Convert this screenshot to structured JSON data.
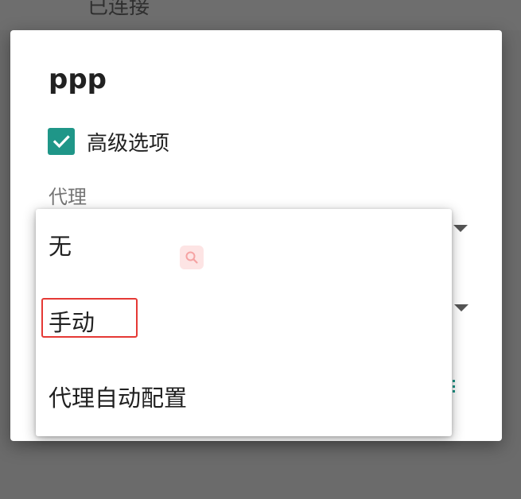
{
  "background": {
    "status_text": "已连接"
  },
  "dialog": {
    "title": "ppp",
    "advanced_options": {
      "label": "高级选项",
      "checked": true
    },
    "proxy_label": "代理"
  },
  "proxy_menu": {
    "options": [
      {
        "label": "无"
      },
      {
        "label": "手动",
        "highlighted": true
      },
      {
        "label": "代理自动配置"
      }
    ]
  },
  "colors": {
    "accent": "#1f9688",
    "highlight_border": "#e53935",
    "scrim": "#6b6b6b"
  },
  "icons": {
    "checkbox": "check-icon",
    "dropdown": "dropdown-arrow-icon",
    "badge": "search-icon"
  }
}
